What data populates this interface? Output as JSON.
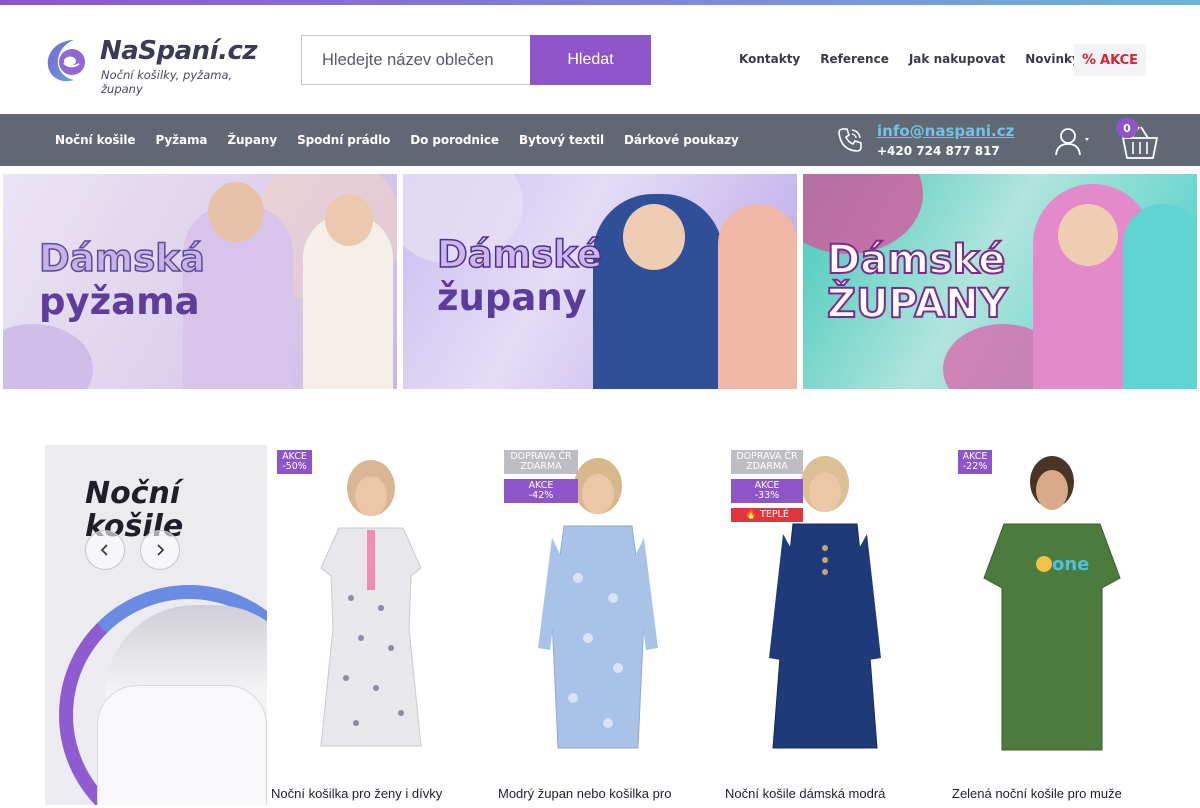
{
  "header": {
    "logo_name": "NaSpaní.cz",
    "logo_tagline": "Noční košilky, pyžama, župany",
    "search_placeholder": "Hledejte název oblečen",
    "search_button": "Hledat",
    "top_links": [
      "Kontakty",
      "Reference",
      "Jak nakupovat",
      "Novinky"
    ],
    "akce_label": "AKCE",
    "akce_icon": "%"
  },
  "nav": {
    "items": [
      "Noční košile",
      "Pyžama",
      "Župany",
      "Spodní prádlo",
      "Do porodnice",
      "Bytový textil",
      "Dárkové poukazy"
    ],
    "email": "info@naspani.cz",
    "phone": "+420 724 877 817",
    "cart_count": "0"
  },
  "banners": [
    {
      "line1": "Dámská",
      "line2": "pyžama"
    },
    {
      "line1": "Dámské",
      "line2": "župany"
    },
    {
      "line1": "Dámské",
      "line2": "ŽUPANY"
    }
  ],
  "promo": {
    "title_line1": "Noční",
    "title_line2": "košile"
  },
  "products": [
    {
      "name": "Noční košilka pro ženy i dívky",
      "badges": [
        {
          "type": "akce",
          "text1": "AKCE",
          "text2": "-50%"
        }
      ],
      "dress_color": "#e7e7ec",
      "accent": "#ef8fb0"
    },
    {
      "name": "Modrý župan nebo košilka pro",
      "badges": [
        {
          "type": "doprava",
          "text1": "DOPRAVA ČR",
          "text2": "ZDARMA"
        },
        {
          "type": "akce",
          "text1": "AKCE",
          "text2": "-42%"
        }
      ],
      "dress_color": "#a9c3e8",
      "accent": "#d7e4f6"
    },
    {
      "name": "Noční košile dámská modrá",
      "badges": [
        {
          "type": "doprava",
          "text1": "DOPRAVA ČR",
          "text2": "ZDARMA"
        },
        {
          "type": "akce",
          "text1": "AKCE",
          "text2": "-33%"
        },
        {
          "type": "teple",
          "text1": "TEPLÉ"
        }
      ],
      "dress_color": "#1f3a79",
      "accent": "#c6a579"
    },
    {
      "name": "Zelená noční košile pro muže",
      "badges": [
        {
          "type": "akce",
          "text1": "AKCE",
          "text2": "-22%"
        }
      ],
      "dress_color": "#4d7a3d",
      "accent": "#4fc1e0",
      "shirt_text": "one"
    }
  ],
  "colors": {
    "brand_purple": "#8e55c9",
    "nav_gray": "#616873",
    "link_blue": "#70c3e3",
    "akce_red": "#e02030"
  }
}
